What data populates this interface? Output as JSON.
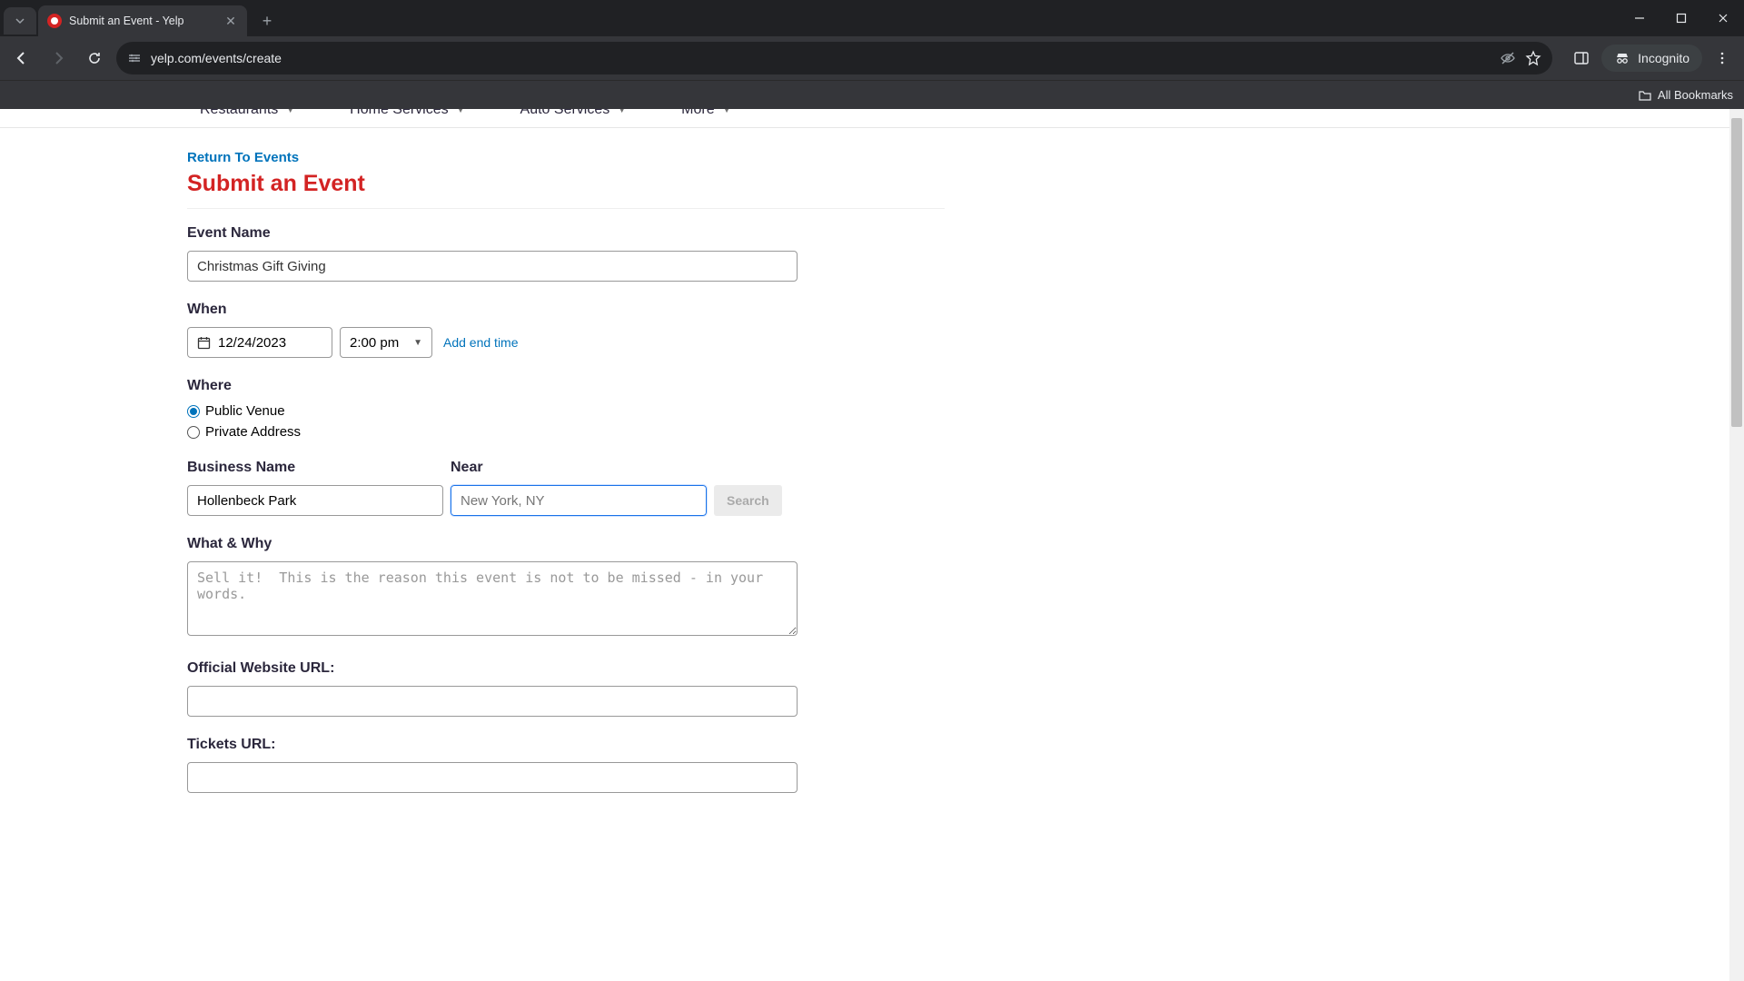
{
  "browser": {
    "tab_title": "Submit an Event - Yelp",
    "url": "yelp.com/events/create",
    "incognito_label": "Incognito",
    "all_bookmarks": "All Bookmarks"
  },
  "top_nav": {
    "items": [
      {
        "label": "Restaurants"
      },
      {
        "label": "Home Services"
      },
      {
        "label": "Auto Services"
      },
      {
        "label": "More"
      }
    ]
  },
  "page": {
    "return_link": "Return To Events",
    "title": "Submit an Event"
  },
  "form": {
    "event_name": {
      "label": "Event Name",
      "value": "Christmas Gift Giving"
    },
    "when": {
      "label": "When",
      "date": "12/24/2023",
      "time": "2:00 pm",
      "add_end_time": "Add end time"
    },
    "where": {
      "label": "Where",
      "public_venue": "Public Venue",
      "private_address": "Private Address",
      "selected": "public"
    },
    "business_name": {
      "label": "Business Name",
      "value": "Hollenbeck Park"
    },
    "near": {
      "label": "Near",
      "placeholder": "New York, NY"
    },
    "search_button": "Search",
    "what_why": {
      "label": "What & Why",
      "placeholder": "Sell it!  This is the reason this event is not to be missed - in your words."
    },
    "website_url": {
      "label": "Official Website URL:"
    },
    "tickets_url": {
      "label": "Tickets URL:"
    }
  }
}
